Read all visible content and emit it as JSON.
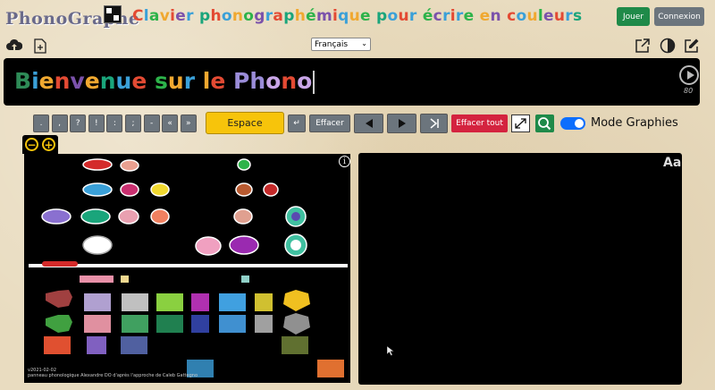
{
  "header": {
    "logo_text": "PhonoGraphe",
    "title_letters": [
      {
        "t": "C",
        "c": "#e34a33"
      },
      {
        "t": "l",
        "c": "#3aa0d8"
      },
      {
        "t": "a",
        "c": "#2db34a"
      },
      {
        "t": "v",
        "c": "#f0a830"
      },
      {
        "t": "i",
        "c": "#e34a33"
      },
      {
        "t": "e",
        "c": "#7b52ab"
      },
      {
        "t": "r",
        "c": "#3aa0d8"
      },
      {
        "t": " ",
        "c": "#000"
      },
      {
        "t": "p",
        "c": "#1aa57b"
      },
      {
        "t": "h",
        "c": "#e34a33"
      },
      {
        "t": "o",
        "c": "#3aa0d8"
      },
      {
        "t": "n",
        "c": "#f0a830"
      },
      {
        "t": "o",
        "c": "#2db34a"
      },
      {
        "t": "g",
        "c": "#7b52ab"
      },
      {
        "t": "r",
        "c": "#3aa0d8"
      },
      {
        "t": "a",
        "c": "#e34a33"
      },
      {
        "t": "p",
        "c": "#1aa57b"
      },
      {
        "t": "h",
        "c": "#f0a830"
      },
      {
        "t": "é",
        "c": "#2db34a"
      },
      {
        "t": "m",
        "c": "#7b52ab"
      },
      {
        "t": "i",
        "c": "#e34a33"
      },
      {
        "t": "q",
        "c": "#3aa0d8"
      },
      {
        "t": "u",
        "c": "#f0a830"
      },
      {
        "t": "e",
        "c": "#2db34a"
      },
      {
        "t": " ",
        "c": "#000"
      },
      {
        "t": "p",
        "c": "#1aa57b"
      },
      {
        "t": "o",
        "c": "#3aa0d8"
      },
      {
        "t": "u",
        "c": "#e34a33"
      },
      {
        "t": "r",
        "c": "#3aa0d8"
      },
      {
        "t": " ",
        "c": "#000"
      },
      {
        "t": "é",
        "c": "#2db34a"
      },
      {
        "t": "c",
        "c": "#7b52ab"
      },
      {
        "t": "r",
        "c": "#3aa0d8"
      },
      {
        "t": "i",
        "c": "#e34a33"
      },
      {
        "t": "r",
        "c": "#3aa0d8"
      },
      {
        "t": "e",
        "c": "#2db34a"
      },
      {
        "t": " ",
        "c": "#000"
      },
      {
        "t": "e",
        "c": "#f0a830"
      },
      {
        "t": "n",
        "c": "#7b52ab"
      },
      {
        "t": " ",
        "c": "#000"
      },
      {
        "t": "c",
        "c": "#e34a33"
      },
      {
        "t": "o",
        "c": "#3aa0d8"
      },
      {
        "t": "u",
        "c": "#f0a830"
      },
      {
        "t": "l",
        "c": "#2db34a"
      },
      {
        "t": "e",
        "c": "#7b52ab"
      },
      {
        "t": "u",
        "c": "#e34a33"
      },
      {
        "t": "r",
        "c": "#3aa0d8"
      },
      {
        "t": "s",
        "c": "#1aa57b"
      }
    ],
    "play_button": "Jouer",
    "login_button": "Connexion"
  },
  "toolbar": {
    "language": "Français"
  },
  "text_display": {
    "letters": [
      {
        "t": "B",
        "c": "#2e8b57"
      },
      {
        "t": "i",
        "c": "#3aa0d8"
      },
      {
        "t": "e",
        "c": "#f0a830"
      },
      {
        "t": "n",
        "c": "#e34a33"
      },
      {
        "t": "v",
        "c": "#7b52ab"
      },
      {
        "t": "e",
        "c": "#f0a830"
      },
      {
        "t": "n",
        "c": "#1aa57b"
      },
      {
        "t": "u",
        "c": "#3aa0d8"
      },
      {
        "t": "e",
        "c": "#e34a33"
      },
      {
        "t": " ",
        "c": "#000"
      },
      {
        "t": "s",
        "c": "#2db34a"
      },
      {
        "t": "u",
        "c": "#f0a830"
      },
      {
        "t": "r",
        "c": "#3aa0d8"
      },
      {
        "t": " ",
        "c": "#000"
      },
      {
        "t": "l",
        "c": "#f0a830"
      },
      {
        "t": "e",
        "c": "#e34a33"
      },
      {
        "t": " ",
        "c": "#000"
      },
      {
        "t": "P",
        "c": "#9a8cd8"
      },
      {
        "t": "h",
        "c": "#9a8cd8"
      },
      {
        "t": "o",
        "c": "#c9a6e8"
      },
      {
        "t": "n",
        "c": "#e34a33"
      },
      {
        "t": "o",
        "c": "#c9a6e8"
      }
    ],
    "speed": "80"
  },
  "keyboard": {
    "punct": [
      ".",
      ",",
      "?",
      "!",
      ":",
      ";",
      "-",
      "«",
      "»"
    ],
    "space": "Espace",
    "enter": "↵",
    "erase": "Effacer",
    "erase_all": "Effacer tout",
    "mode_label": "Mode Graphies"
  },
  "panel_right": {
    "font_toggle": "Aa"
  },
  "credit": {
    "date": "v2021-02-02",
    "line": "panneau phonologique Alexandre DO   d'après l'approche de Caleb Gattegno"
  },
  "colors": {
    "accent_green": "#1f8a49",
    "grey_button": "#6c757d",
    "espace_yellow": "#f7c40b",
    "danger_red": "#d4233f",
    "toggle_blue": "#0d6efd"
  }
}
